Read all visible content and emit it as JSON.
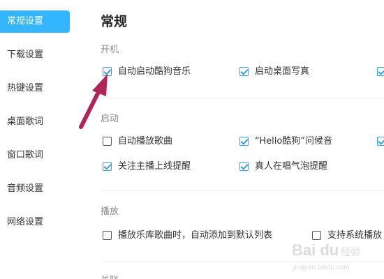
{
  "sidebar": {
    "items": [
      {
        "label": "常规设置",
        "active": true
      },
      {
        "label": "下载设置",
        "active": false
      },
      {
        "label": "热键设置",
        "active": false
      },
      {
        "label": "桌面歌词",
        "active": false
      },
      {
        "label": "窗口歌词",
        "active": false
      },
      {
        "label": "音频设置",
        "active": false
      },
      {
        "label": "网络设置",
        "active": false
      }
    ]
  },
  "main": {
    "title": "常规",
    "sections": {
      "startup": {
        "title": "开机",
        "options": [
          {
            "label": "自动启动酷狗音乐",
            "checked": true
          },
          {
            "label": "启动桌面写真",
            "checked": true
          }
        ]
      },
      "launch": {
        "title": "启动",
        "options": [
          {
            "label": "自动播放歌曲",
            "checked": false
          },
          {
            "label": "“Hello酷狗”问候音",
            "checked": true
          },
          {
            "label": "关注主播上线提醒",
            "checked": true
          },
          {
            "label": "真人在唱气泡提醒",
            "checked": true
          }
        ]
      },
      "playback": {
        "title": "播放",
        "options": [
          {
            "label": "播放乐库歌曲时，自动添加到默认列表",
            "checked": false
          },
          {
            "label": "支持系统播放",
            "checked": false
          }
        ]
      },
      "association": {
        "title": "关联"
      }
    }
  },
  "watermark": {
    "text": "Bai du 经验",
    "subtext": "jingyan.baidu.com"
  },
  "colors": {
    "accent": "#33b6ff",
    "check": "#33a0e0",
    "arrow": "#b0245a"
  }
}
